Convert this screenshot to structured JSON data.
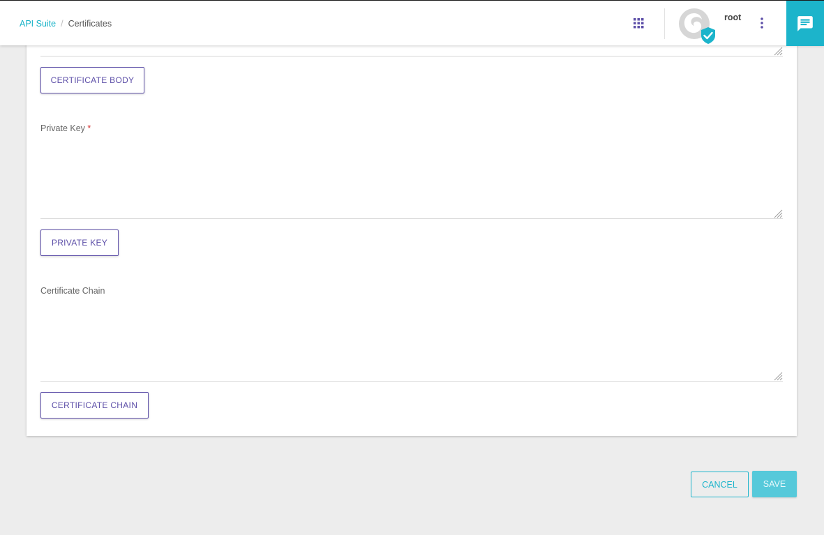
{
  "breadcrumb": {
    "root": "API Suite",
    "separator": "/",
    "current": "Certificates"
  },
  "header": {
    "username": "root",
    "icons": [
      "apps-grid-icon",
      "avatar-verified-icon",
      "more-vertical-icon",
      "chat-icon"
    ]
  },
  "form": {
    "certificate_body_button": "CERTIFICATE BODY",
    "private_key": {
      "label": "Private Key",
      "required_mark": "*",
      "value": "",
      "button": "PRIVATE KEY"
    },
    "certificate_chain": {
      "label": "Certificate Chain",
      "value": "",
      "button": "CERTIFICATE CHAIN"
    }
  },
  "footer": {
    "cancel_label": "CANCEL",
    "save_label": "SAVE"
  },
  "colors": {
    "accent_cyan": "#1cb4cb",
    "purple": "#5d4fa8",
    "background": "#ededed"
  }
}
